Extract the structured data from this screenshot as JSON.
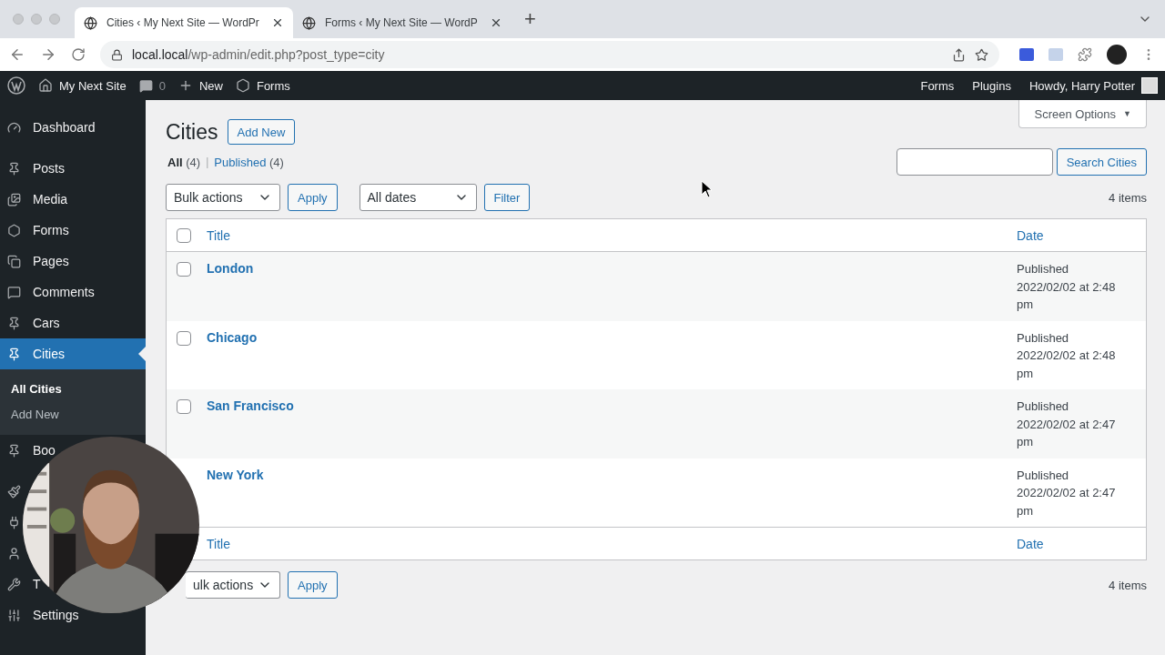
{
  "browser": {
    "tabs": [
      {
        "title": "Cities ‹ My Next Site — WordPr",
        "selected": true
      },
      {
        "title": "Forms ‹ My Next Site — WordP",
        "selected": false
      }
    ],
    "new_tab": "+",
    "url_host": "local.local",
    "url_path": "/wp-admin/edit.php?post_type=city"
  },
  "admin_bar": {
    "site": "My Next Site",
    "comments": "0",
    "new": "New",
    "forms": "Forms",
    "right": [
      "Forms",
      "Plugins"
    ],
    "greeting": "Howdy, Harry Potter"
  },
  "sidebar": {
    "items": [
      {
        "label": "Dashboard",
        "selected": false
      },
      {
        "kind": "separator"
      },
      {
        "label": "Posts",
        "selected": false
      },
      {
        "label": "Media",
        "selected": false
      },
      {
        "label": "Forms",
        "selected": false
      },
      {
        "label": "Pages",
        "selected": false
      },
      {
        "label": "Comments",
        "selected": false
      },
      {
        "label": "Cars",
        "selected": false
      },
      {
        "label": "Cities",
        "selected": true,
        "submenu": [
          {
            "label": "All Cities",
            "selected": true
          },
          {
            "label": "Add New",
            "selected": false
          }
        ]
      },
      {
        "label": "Boo",
        "selected": false
      },
      {
        "kind": "separator"
      },
      {
        "selected": false
      },
      {
        "selected": false
      },
      {
        "selected": false
      },
      {
        "label": "T",
        "selected": false
      },
      {
        "label": "Settings",
        "selected": false
      }
    ]
  },
  "screen_options": {
    "label": "Screen Options",
    "caret": "▼"
  },
  "page": {
    "title": "Cities",
    "add_new": "Add New"
  },
  "views": [
    {
      "label": "All",
      "count": "(4)",
      "selected": true
    },
    {
      "label": "Published",
      "count": "(4)",
      "selected": false
    }
  ],
  "views_separator": "|",
  "search": {
    "button": "Search Cities"
  },
  "top_actions": {
    "bulk": "Bulk actions",
    "apply": "Apply",
    "dates": "All dates",
    "filter": "Filter",
    "count": "4 items"
  },
  "table": {
    "columns": [
      "Title",
      "Date"
    ],
    "header_checked": false,
    "rows": [
      {
        "title": "London",
        "status": "Published",
        "date": "2022/02/02 at 2:48 pm",
        "checked": false
      },
      {
        "title": "Chicago",
        "status": "Published",
        "date": "2022/02/02 at 2:48 pm",
        "checked": false
      },
      {
        "title": "San Francisco",
        "status": "Published",
        "date": "2022/02/02 at 2:47 pm",
        "checked": false
      },
      {
        "title": "New York",
        "status": "Published",
        "date": "2022/02/02 at 2:47 pm"
      }
    ],
    "footer_columns": [
      "Title",
      "Date"
    ]
  },
  "bottom_actions": {
    "bulk": "ulk actions",
    "apply": "Apply",
    "count": "4 items"
  }
}
